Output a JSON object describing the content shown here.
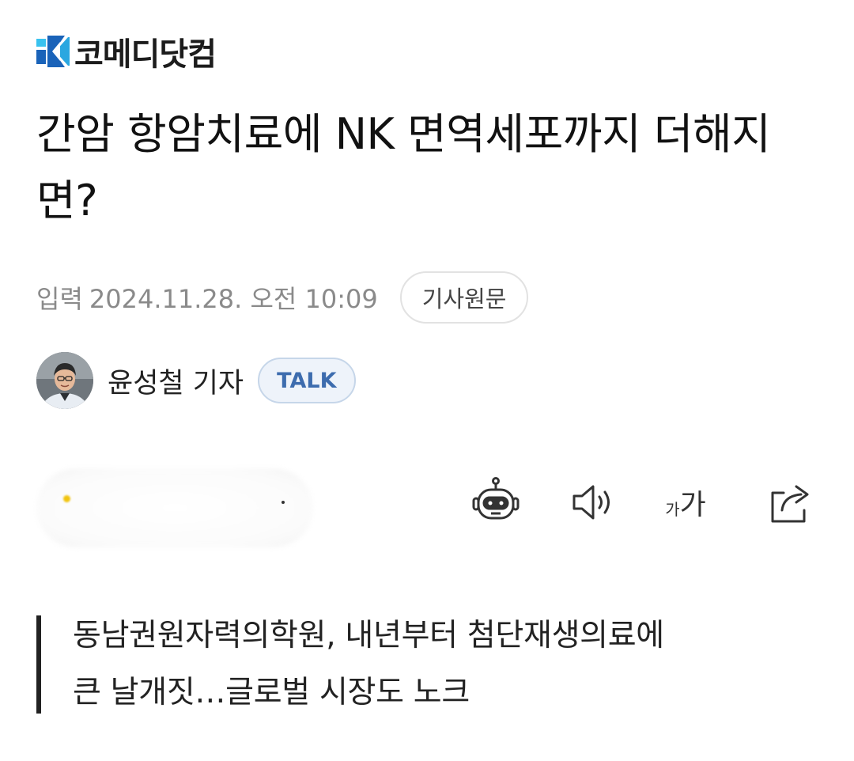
{
  "header": {
    "logo_text": "코메디닷컴",
    "logo_colors": {
      "dark": "#1a63b9",
      "light": "#2aa7e0",
      "accent": "#39c2ef"
    }
  },
  "article": {
    "headline": "간암 항암치료에 NK 면역세포까지 더해지면?",
    "dateline": {
      "label": "입력",
      "value": "2024.11.28. 오전 10:09"
    },
    "original_button_label": "기사원문",
    "reporter": {
      "name": "윤성철 기자",
      "badge": "TALK"
    },
    "toolbar": {
      "icons": [
        "robot-summary-icon",
        "speaker-icon",
        "font-size-icon",
        "share-icon"
      ],
      "font_size_small": "가",
      "font_size_large": "가"
    },
    "summary": {
      "line1": "동남권원자력의학원, 내년부터 첨단재생의료에",
      "line2": "큰 날개짓…글로벌 시장도 노크"
    }
  }
}
